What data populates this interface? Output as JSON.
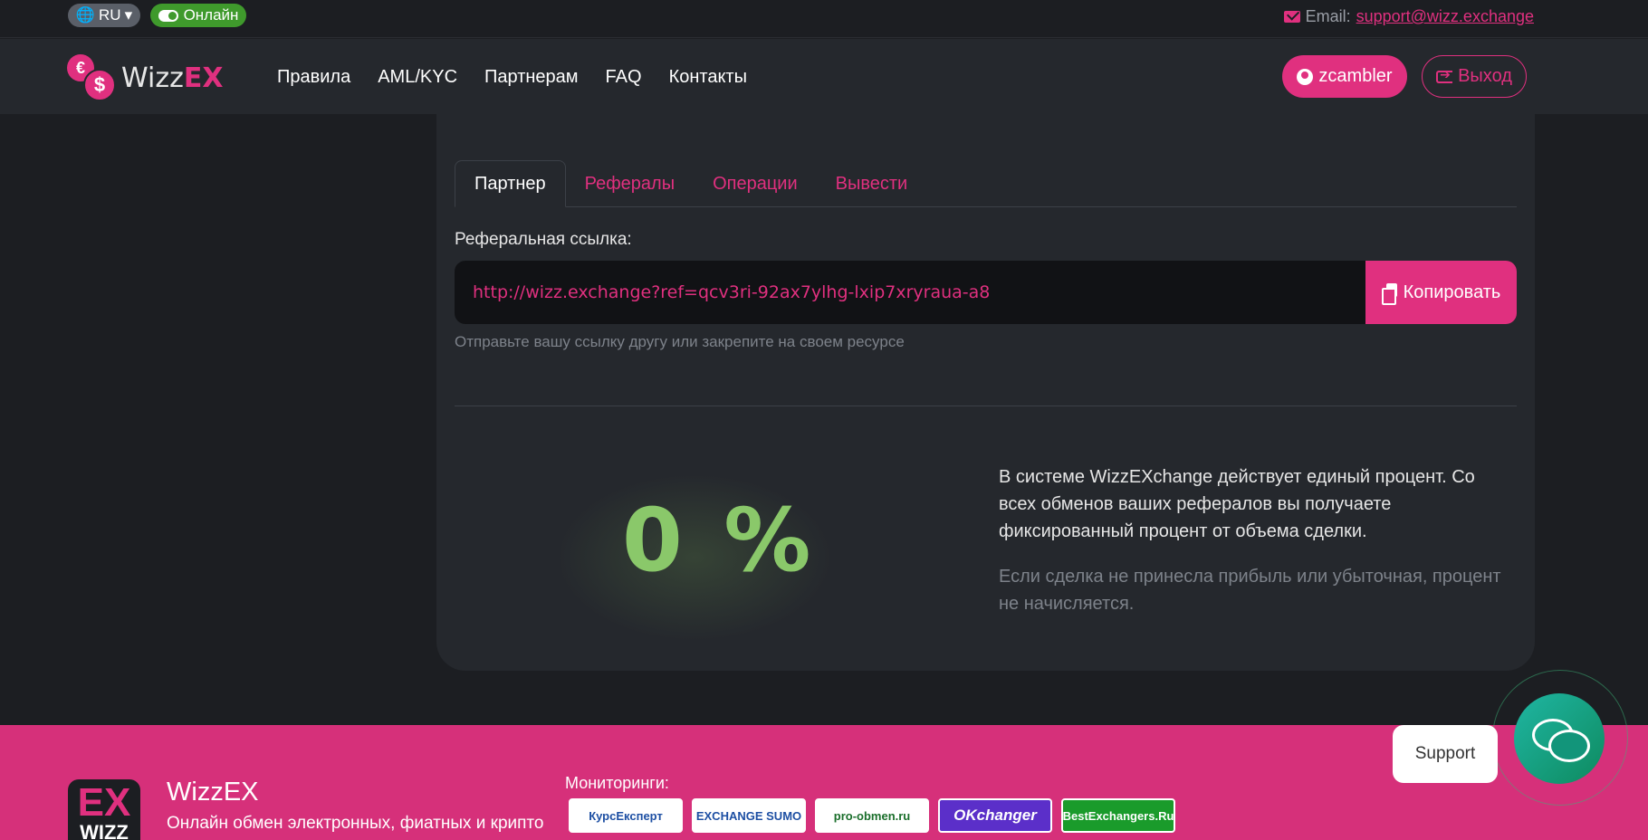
{
  "topbar": {
    "language": "RU",
    "status": "Онлайн",
    "email_label": "Email:",
    "email": "support@wizz.exchange"
  },
  "header": {
    "logo_main": "Wizz",
    "logo_accent": "EX",
    "nav": [
      "Правила",
      "AML/KYC",
      "Партнерам",
      "FAQ",
      "Контакты"
    ],
    "username": "zcambler",
    "logout": "Выход"
  },
  "partner": {
    "tabs": [
      "Партнер",
      "Рефералы",
      "Операции",
      "Вывести"
    ],
    "active_tab": "Партнер",
    "ref_label": "Реферальная ссылка:",
    "ref_link": "http://wizz.exchange?ref=qcv3ri-92ax7ylhg-lxip7xryraua-a8",
    "copy_label": "Копировать",
    "ref_hint": "Отправьте вашу ссылку другу или закрепите на своем ресурсе",
    "percent": "0 %",
    "info_primary": "В системе WizzEXchange действует единый процент. Со всех обменов ваших рефералов вы получаете фиксированный процент от объема сделки.",
    "info_secondary": "Если сделка не принесла прибыль или убыточная, процент не начисляется."
  },
  "footer": {
    "logo_top": "EX",
    "logo_bottom": "WIZZ",
    "brand": "WizzEX",
    "description": "Онлайн обмен электронных, фиатных и крипто",
    "monitors_label": "Мониторинги:",
    "monitors": [
      "КурсЕксперт",
      "EXCHANGE SUMO",
      "pro-obmen.ru",
      "OKchanger",
      "BestExchangers.Ru"
    ]
  },
  "support": {
    "label": "Support"
  },
  "colors": {
    "accent": "#e0307f",
    "online": "#3f9a2c",
    "percent": "#8ac86a",
    "footer": "#d6307a"
  },
  "icons": [
    "globe-icon",
    "toggle-icon",
    "mail-icon",
    "user-icon",
    "logout-icon",
    "copy-icon",
    "chat-icon"
  ]
}
